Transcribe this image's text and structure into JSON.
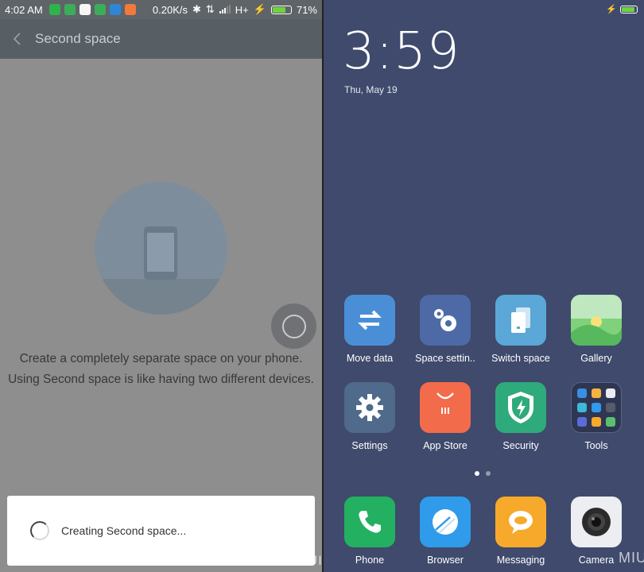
{
  "left_screen": {
    "status": {
      "time": "4:02 AM",
      "speed": "0.20K/s",
      "network": "H+",
      "battery": "71%",
      "battery_level": 0.71
    },
    "appbar": {
      "title": "Second space"
    },
    "description": {
      "line1": "Create a completely separate space on your phone.",
      "line2": "Using Second space is like having two different devices."
    },
    "dialog": {
      "message": "Creating Second space..."
    },
    "watermark": "MIUI",
    "colors": {
      "bg": "#8e8e8e",
      "appbar": "#585f64"
    }
  },
  "right_screen": {
    "clock": "3:59",
    "date": "Thu, May 19",
    "apps": [
      {
        "label": "Move data",
        "icon": "move-data-icon",
        "color": "#4a8fd6"
      },
      {
        "label": "Space settin..",
        "icon": "space-settings-icon",
        "color": "#4d6aa6"
      },
      {
        "label": "Switch space",
        "icon": "switch-space-icon",
        "color": "#5aa7d8"
      },
      {
        "label": "Gallery",
        "icon": "gallery-icon",
        "color": "#7fd27a"
      },
      {
        "label": "Settings",
        "icon": "settings-icon",
        "color": "#4f6a8a"
      },
      {
        "label": "App Store",
        "icon": "app-store-icon",
        "color": "#f26b4a"
      },
      {
        "label": "Security",
        "icon": "security-icon",
        "color": "#2faa7c"
      },
      {
        "label": "Tools",
        "icon": "tools-folder-icon",
        "color": "#2e3652"
      }
    ],
    "dock": [
      {
        "label": "Phone",
        "icon": "phone-icon",
        "color": "#23b161"
      },
      {
        "label": "Browser",
        "icon": "browser-icon",
        "color": "#2f9bea"
      },
      {
        "label": "Messaging",
        "icon": "messaging-icon",
        "color": "#f7a92b"
      },
      {
        "label": "Camera",
        "icon": "camera-icon",
        "color": "#eceef2"
      }
    ],
    "page_dots": 2,
    "active_page": 1,
    "watermark": "MIUI",
    "colors": {
      "bg": "#3f4a6c"
    }
  }
}
